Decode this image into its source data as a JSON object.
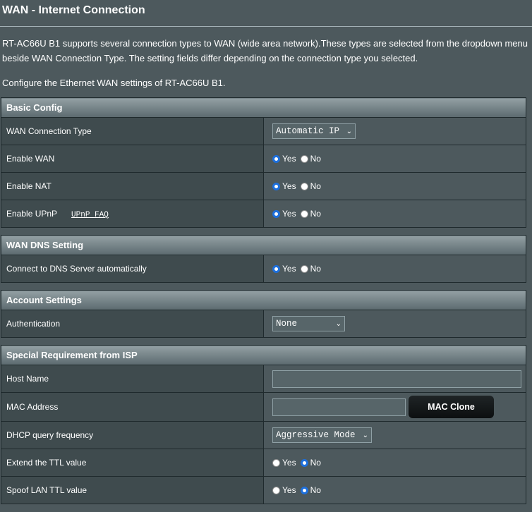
{
  "page": {
    "title": "WAN - Internet Connection",
    "description": "RT-AC66U B1 supports several connection types to WAN (wide area network).These types are selected from the dropdown menu beside WAN Connection Type. The setting fields differ depending on the connection type you selected.",
    "configure_text": "Configure the Ethernet WAN settings of RT-AC66U B1."
  },
  "radio": {
    "yes": "Yes",
    "no": "No"
  },
  "basic_config": {
    "header": "Basic Config",
    "wan_type_label": "WAN Connection Type",
    "wan_type_value": "Automatic IP",
    "enable_wan_label": "Enable WAN",
    "enable_wan_value": "Yes",
    "enable_nat_label": "Enable NAT",
    "enable_nat_value": "Yes",
    "enable_upnp_label": "Enable UPnP",
    "upnp_faq": "UPnP  FAQ",
    "enable_upnp_value": "Yes"
  },
  "wan_dns": {
    "header": "WAN DNS Setting",
    "auto_dns_label": "Connect to DNS Server automatically",
    "auto_dns_value": "Yes"
  },
  "account": {
    "header": "Account Settings",
    "auth_label": "Authentication",
    "auth_value": "None"
  },
  "isp": {
    "header": "Special Requirement from ISP",
    "host_name_label": "Host Name",
    "host_name_value": "",
    "mac_label": "MAC Address",
    "mac_value": "",
    "mac_clone_button": "MAC Clone",
    "dhcp_freq_label": "DHCP query frequency",
    "dhcp_freq_value": "Aggressive Mode",
    "ttl_label": "Extend the TTL value",
    "ttl_value": "No",
    "spoof_ttl_label": "Spoof LAN TTL value",
    "spoof_ttl_value": "No"
  }
}
